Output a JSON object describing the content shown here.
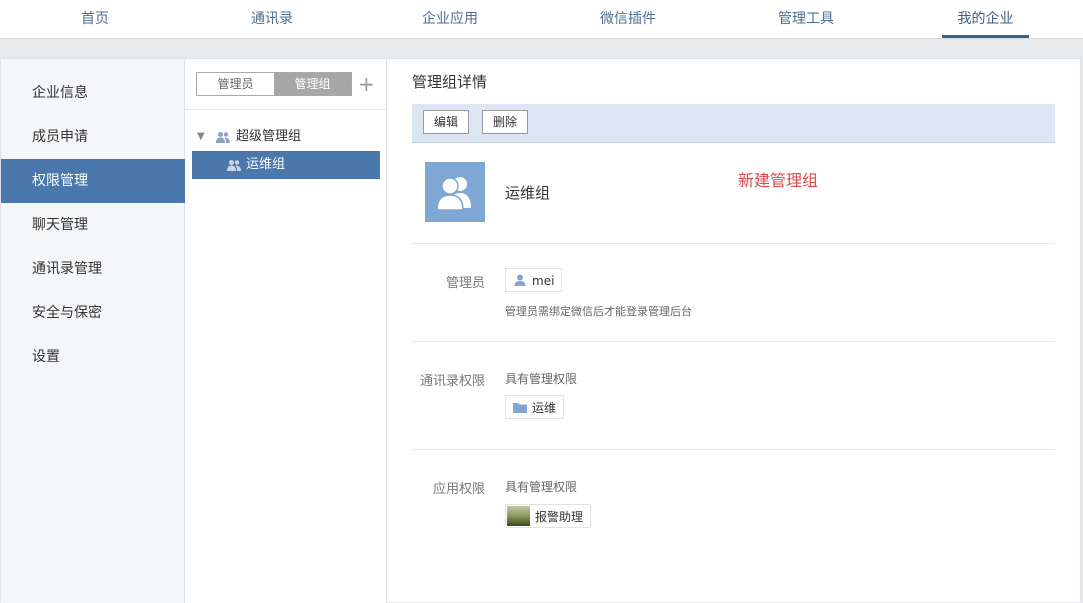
{
  "topnav": {
    "items": [
      {
        "label": "首页"
      },
      {
        "label": "通讯录"
      },
      {
        "label": "企业应用"
      },
      {
        "label": "微信插件"
      },
      {
        "label": "管理工具"
      },
      {
        "label": "我的企业",
        "active": true
      }
    ]
  },
  "leftmenu": {
    "items": [
      {
        "label": "企业信息"
      },
      {
        "label": "成员申请"
      },
      {
        "label": "权限管理",
        "active": true
      },
      {
        "label": "聊天管理"
      },
      {
        "label": "通讯录管理"
      },
      {
        "label": "安全与保密"
      },
      {
        "label": "设置"
      }
    ]
  },
  "tree": {
    "tabs": [
      {
        "label": "管理员"
      },
      {
        "label": "管理组",
        "active": true
      }
    ],
    "add_icon": "plus-icon",
    "add_label": "+",
    "caret": "▼",
    "root": {
      "label": "超级管理组",
      "icon": "people-icon"
    },
    "child": {
      "label": "运维组",
      "icon": "people-icon",
      "selected": true
    }
  },
  "detail": {
    "title": "管理组详情",
    "toolbar": {
      "edit_label": "编辑",
      "delete_label": "删除"
    },
    "group": {
      "name": "运维组",
      "avatar_icon": "group-avatar-icon"
    },
    "new_group_link": "新建管理组",
    "admins": {
      "label": "管理员",
      "members": [
        {
          "name": "mei",
          "icon": "user-icon"
        }
      ],
      "hint": "管理员需绑定微信后才能登录管理后台"
    },
    "contacts_perm": {
      "label": "通讯录权限",
      "subtitle": "具有管理权限",
      "items": [
        {
          "name": "运维",
          "icon": "folder-icon"
        }
      ]
    },
    "apps_perm": {
      "label": "应用权限",
      "subtitle": "具有管理权限",
      "items": [
        {
          "name": "报警助理",
          "icon": "app-thumbnail"
        }
      ]
    }
  },
  "colors": {
    "accent": "#4a77ac",
    "nav_text": "#4d6f93",
    "toolbar_bg": "#dce6f2",
    "new_link": "#e0474a"
  }
}
